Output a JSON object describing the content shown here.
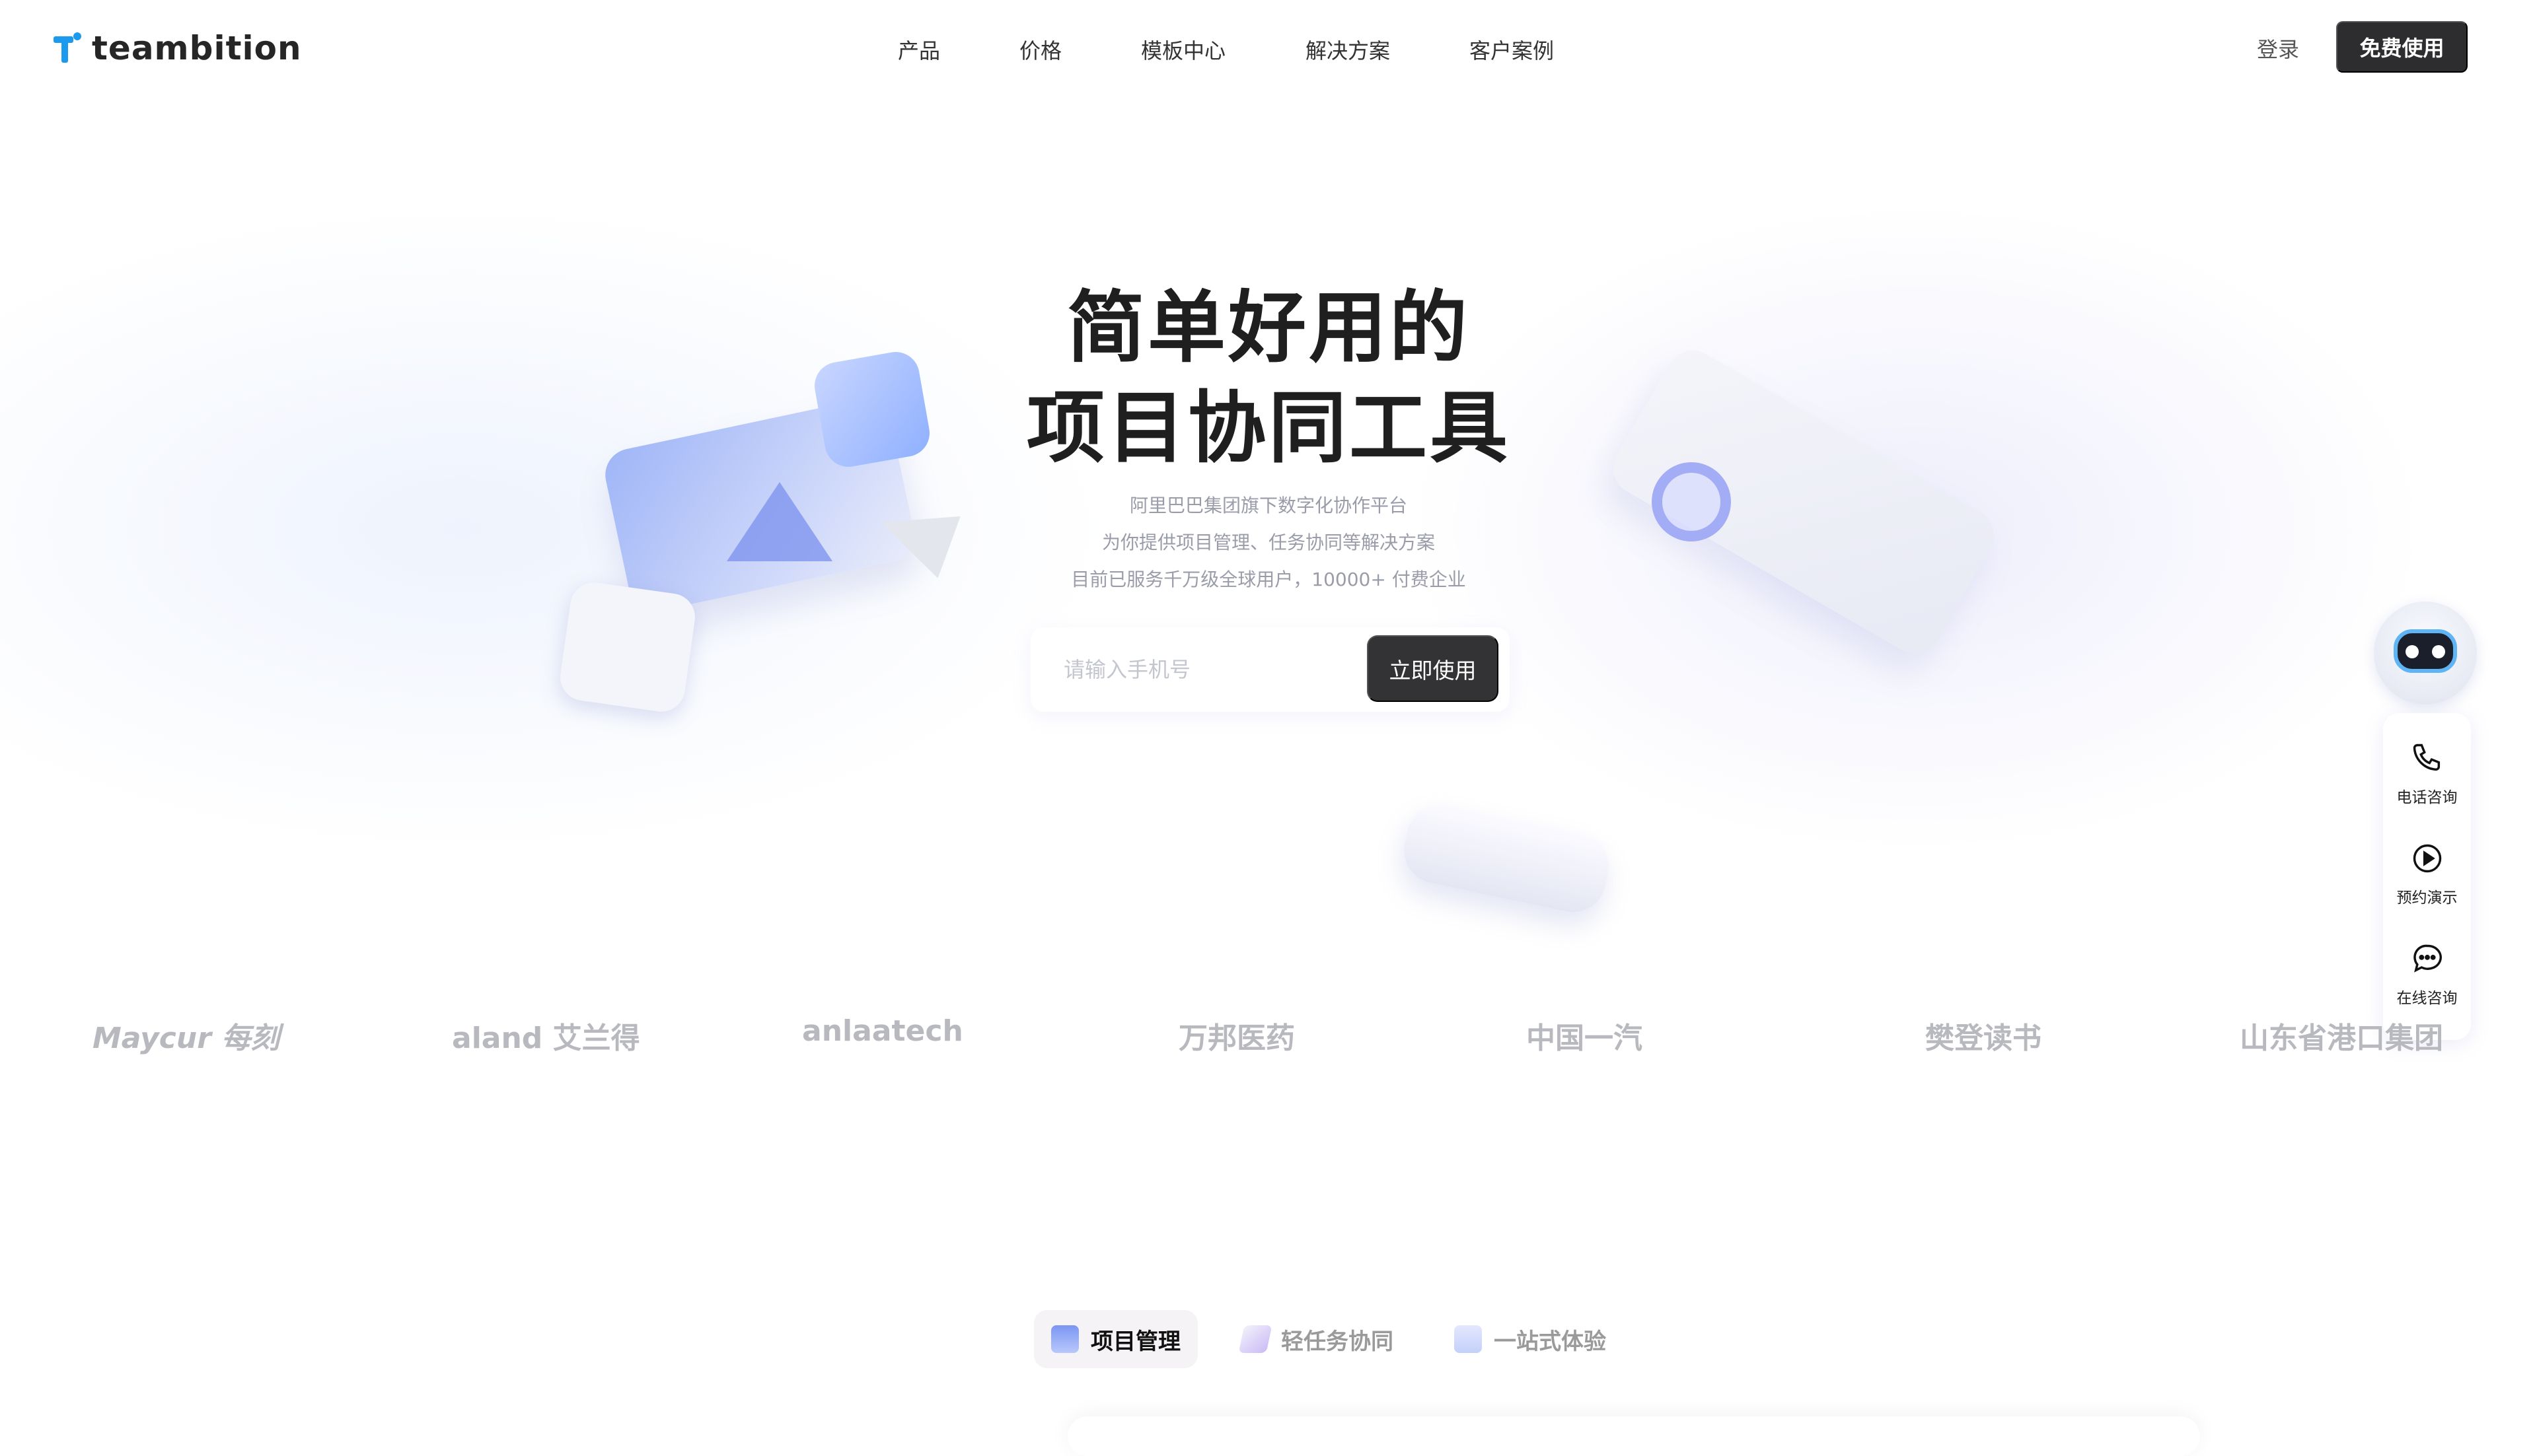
{
  "header": {
    "brand": "teambition",
    "nav": [
      {
        "label": "产品"
      },
      {
        "label": "价格"
      },
      {
        "label": "模板中心"
      },
      {
        "label": "解决方案"
      },
      {
        "label": "客户案例"
      }
    ],
    "login_label": "登录",
    "cta_label": "免费使用"
  },
  "hero": {
    "title_line1": "简单好用的",
    "title_line2": "项目协同工具",
    "subtitle": [
      "阿里巴巴集团旗下数字化协作平台",
      "为你提供项目管理、任务协同等解决方案",
      "目前已服务千万级全球用户，10000+ 付费企业"
    ],
    "phone_input": {
      "value": "",
      "placeholder": "请输入手机号"
    },
    "submit_label": "立即使用"
  },
  "float_panel": {
    "assistant_icon": "robot-icon",
    "items": [
      {
        "label": "电话咨询",
        "icon": "phone-icon"
      },
      {
        "label": "预约演示",
        "icon": "play-circle-icon"
      },
      {
        "label": "在线咨询",
        "icon": "chat-bubble-icon"
      }
    ]
  },
  "customer_logos": [
    "Maycur 每刻",
    "aland 艾兰得",
    "anlaatech",
    "万邦医药",
    "中国一汽",
    "樊登读书",
    "山东省港口集团"
  ],
  "feature_tabs": [
    {
      "label": "项目管理",
      "active": true
    },
    {
      "label": "轻任务协同",
      "active": false
    },
    {
      "label": "一站式体验",
      "active": false
    }
  ],
  "colors": {
    "brand": "#1b9aee",
    "dark_button": "#2d2d2f"
  }
}
